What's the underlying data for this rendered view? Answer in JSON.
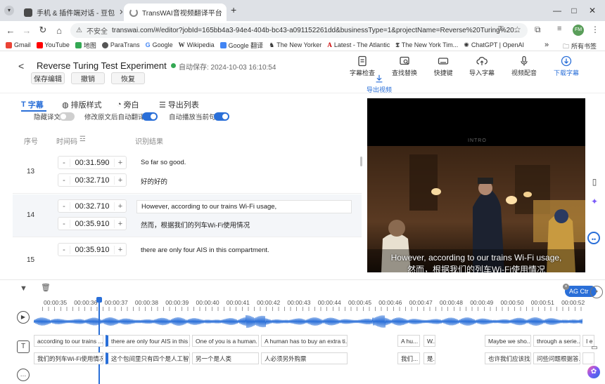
{
  "browser": {
    "tabs": [
      {
        "title": "手机 & 插件端对话 - 豆包"
      },
      {
        "title": "TransWAI音视频翻译平台"
      }
    ],
    "new_tab": "+",
    "security_label": "不安全",
    "url": "transwai.com/#/editor?jobId=165bb4a3-94e4-404b-bc43-a091152261dd&businessType=1&projectName=Reverse%20Turing%20...",
    "profile_initials": "FM",
    "bookmarks": [
      "Gmail",
      "YouTube",
      "地图",
      "ParaTrans",
      "Google",
      "Wikipedia",
      "Google 翻译",
      "The New Yorker",
      "Latest - The Atlantic",
      "The New York Tim...",
      "ChatGPT | OpenAI"
    ],
    "bookmarks_more": "»",
    "all_bookmarks": "所有书签"
  },
  "app": {
    "back": "<",
    "project_title": "Reverse Turing Test Experiment",
    "autosave": "自动保存: 2024-10-03 16:10:54",
    "save_btn": "保存编辑",
    "undo_btn": "撤销",
    "redo_btn": "恢复",
    "tools": [
      {
        "label": "字幕检查",
        "icon": "document-check-icon"
      },
      {
        "label": "查找替换",
        "icon": "find-replace-icon"
      },
      {
        "label": "快捷键",
        "icon": "keyboard-icon"
      },
      {
        "label": "导入字幕",
        "icon": "upload-cloud-icon"
      },
      {
        "label": "视频配音",
        "icon": "microphone-icon"
      },
      {
        "label": "下载字幕",
        "icon": "download-circle-icon"
      }
    ],
    "export_video": "导出视频"
  },
  "editor": {
    "tabs": [
      "字幕",
      "排版样式",
      "旁白",
      "导出列表"
    ],
    "toggle_hide_original": {
      "label": "隐藏译文",
      "on": false
    },
    "toggle_auto_translate": {
      "label": "修改原文后自动翻译",
      "on": true
    },
    "toggle_autoplay": {
      "label": "自动播放当前句",
      "on": true
    },
    "col_index": "序号",
    "col_time": "时间码",
    "col_result": "识别结果",
    "rows": [
      {
        "index": "13",
        "start": "00:31.590",
        "end": "00:32.710",
        "src": "So far so good.",
        "tgt": "好的好的"
      },
      {
        "index": "14",
        "start": "00:32.710",
        "end": "00:35.910",
        "src": "However, according to our trains Wi-Fi usage,",
        "tgt": "然而，根据我们的列车Wi-Fi使用情况"
      },
      {
        "index": "15",
        "start": "00:35.910",
        "end": "",
        "src": "there are only four AIS in this compartment.",
        "tgt": ""
      }
    ],
    "minus": "-",
    "plus": "+"
  },
  "video": {
    "intro_label": "INTRO",
    "subtitle_en": "However, according to our trains Wi-Fi usage,",
    "subtitle_zh": "然而，根据我们的列车Wi-Fi使用情况"
  },
  "timeline": {
    "ticks": [
      "00:00:35",
      "00:00:36",
      "00:00:37",
      "00:00:38",
      "00:00:39",
      "00:00:40",
      "00:00:41",
      "00:00:42",
      "00:00:43",
      "00:00:44",
      "00:00:45",
      "00:00:46",
      "00:00:47",
      "00:00:48",
      "00:00:49",
      "00:00:50",
      "00:00:51",
      "00:00:52"
    ],
    "segments_top": [
      "according to our trains ...",
      "there are only four AIS in this ...",
      "One of you is a human.",
      "A human has to buy an extra ti...",
      "A hu...",
      "W...",
      "Maybe we sho...",
      "through a serie...",
      "I e"
    ],
    "segments_bottom": [
      "我们的列车Wi-Fi使用情况",
      "这个包间里只有四个是人工智能",
      "另一个是人类",
      "人必须另外购票",
      "我们...",
      "是...",
      "也许我们应该找...",
      "问些问题根据答...",
      ""
    ],
    "ai_badge": "AG Ctr"
  },
  "colors": {
    "accent": "#2a6fd8",
    "toggle_off": "#cfcfcf",
    "autosave_dot": "#34a853",
    "waveform": "#2a6fd8"
  }
}
